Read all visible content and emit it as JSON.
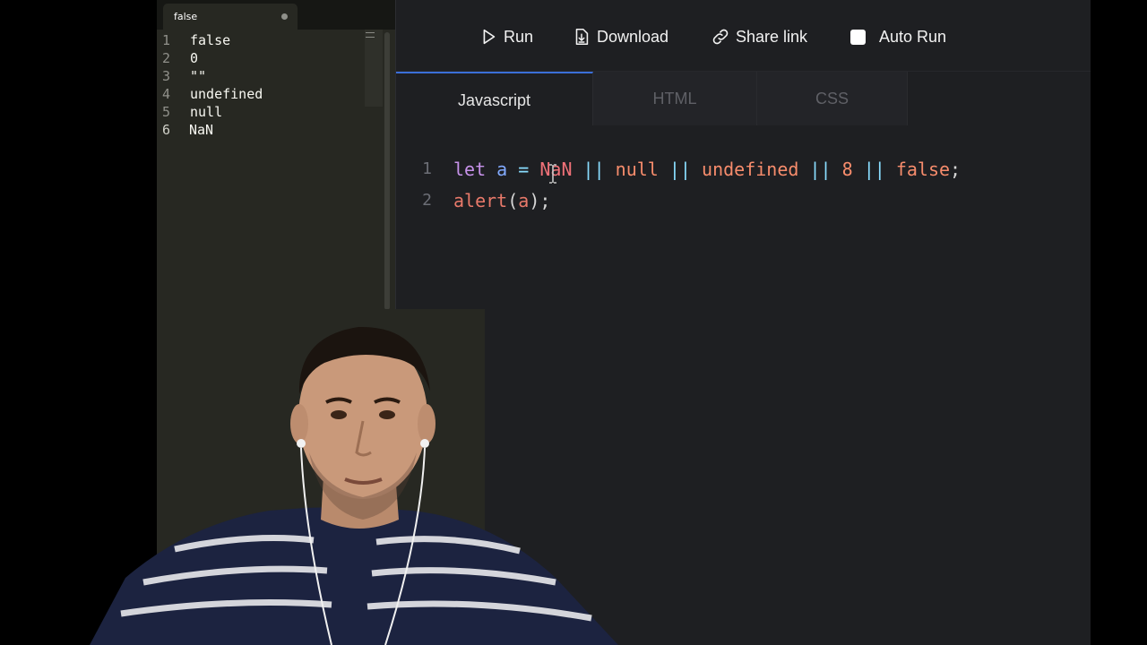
{
  "left_editor": {
    "tab_title": "false",
    "lines": [
      {
        "num": "1",
        "text": "false"
      },
      {
        "num": "2",
        "text": "0"
      },
      {
        "num": "3",
        "text": "\"\""
      },
      {
        "num": "4",
        "text": "undefined"
      },
      {
        "num": "5",
        "text": "null"
      },
      {
        "num": "6",
        "text": "NaN"
      }
    ]
  },
  "toolbar": {
    "run_label": "Run",
    "download_label": "Download",
    "share_label": "Share link",
    "autorun_label": "Auto Run",
    "autorun_checked": false
  },
  "tabs": {
    "javascript": "Javascript",
    "html": "HTML",
    "css": "CSS",
    "active": "Javascript"
  },
  "code": {
    "line1": {
      "num": "1",
      "kw": "let",
      "var": "a",
      "eq": "=",
      "t1": "NaN",
      "or1": "||",
      "t2": "null",
      "or2": "||",
      "t3": "undefined",
      "or3": "||",
      "t4": "8",
      "or4": "||",
      "t5": "false",
      "end": ";"
    },
    "line2": {
      "num": "2",
      "fn": "alert",
      "open": "(",
      "arg": "a",
      "close": ");"
    }
  },
  "colors": {
    "accent_tab": "#3b6fd8",
    "keyword": "#c792ea",
    "variable": "#82aaff",
    "operator": "#89ddff",
    "literal": "#f78c6c"
  }
}
